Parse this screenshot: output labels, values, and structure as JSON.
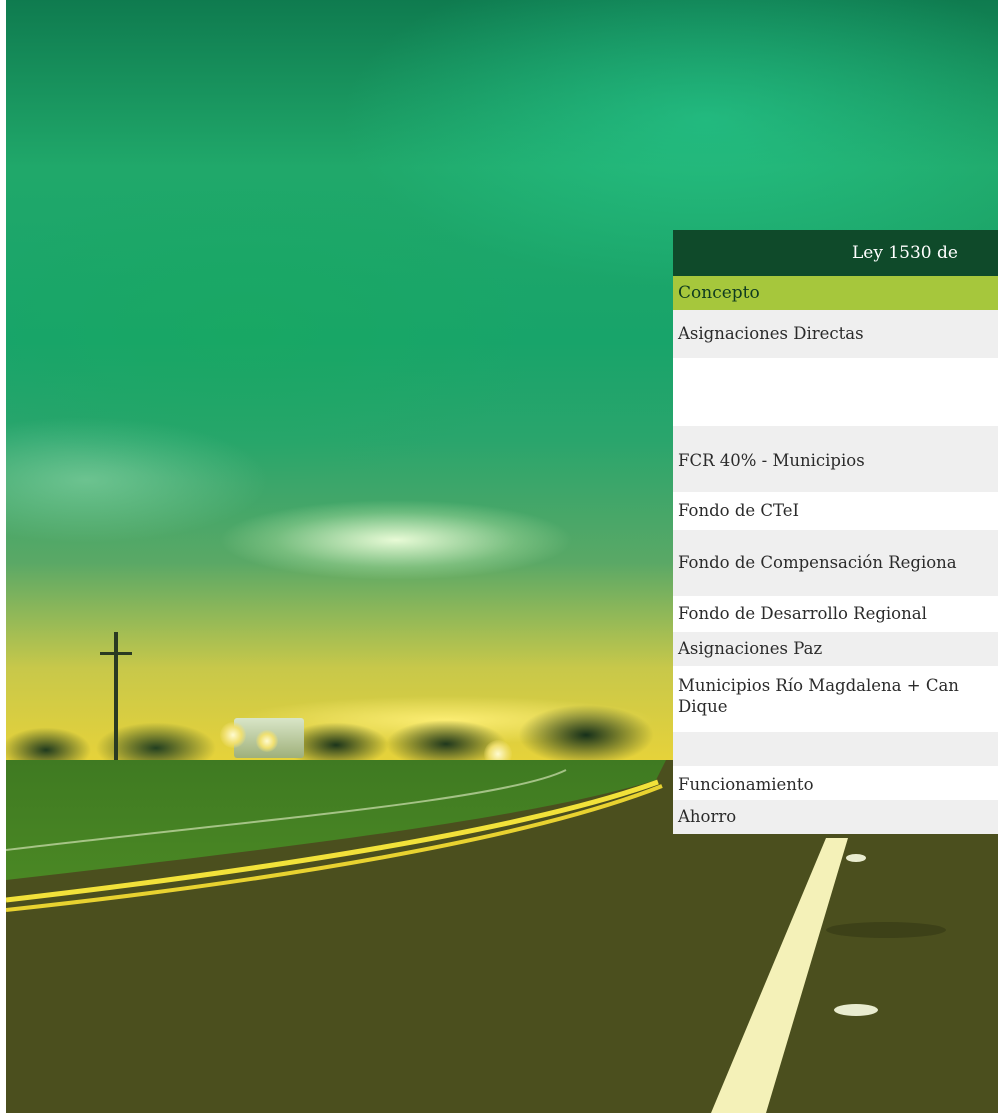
{
  "table": {
    "title": "Ley 1530 de",
    "header": {
      "concept": "Concepto"
    },
    "rows": [
      {
        "label": "Asignaciones Directas"
      },
      {
        "label": ""
      },
      {
        "label": "FCR 40% - Municipios"
      },
      {
        "label": "Fondo de CTeI"
      },
      {
        "label": "Fondo de Compensación Regiona"
      },
      {
        "label": "Fondo de Desarrollo Regional"
      },
      {
        "label": "Asignaciones Paz"
      },
      {
        "label": "Municipios Río Magdalena + Can"
      },
      {
        "label": "Dique"
      },
      {
        "label": ""
      },
      {
        "label": "Funcionamiento"
      },
      {
        "label": "Ahorro"
      }
    ]
  },
  "colors": {
    "title_bg": "#0f4a2a",
    "header_bg": "#a6c73c",
    "row_shade": "#efefef"
  }
}
